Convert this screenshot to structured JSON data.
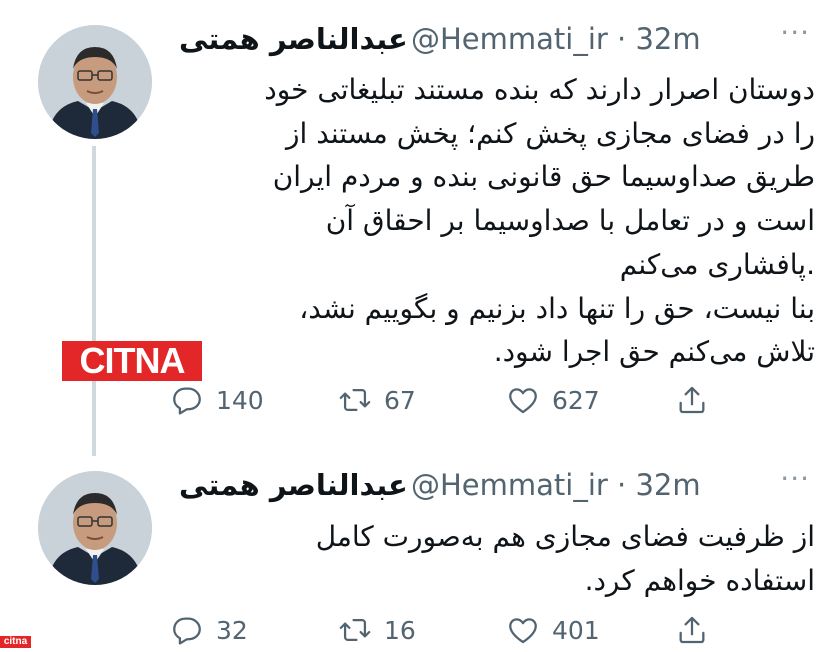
{
  "tweets": [
    {
      "author_name": "عبدالناصر همتی",
      "handle": "@Hemmati_ir",
      "separator": "·",
      "time": "32m",
      "more_icon": "more-horizontal-icon",
      "text_lines": [
        "دوستان اصرار دارند که بنده مستند تبلیغاتی خود",
        "را در فضای مجازی پخش کنم؛ پخش مستند از",
        "طریق صداوسیما حق قانونی بنده و مردم ایران",
        "است و در تعامل با صداوسیما بر احقاق آن",
        ".پافشاری می‌کنم",
        "بنا نیست، حق را تنها داد بزنیم و بگوییم نشد،",
        "تلاش می‌کنم حق اجرا شود."
      ],
      "replies": "140",
      "retweets": "67",
      "likes": "627"
    },
    {
      "author_name": "عبدالناصر همتی",
      "handle": "@Hemmati_ir",
      "separator": "·",
      "time": "32m",
      "more_icon": "more-horizontal-icon",
      "text_lines": [
        "از ظرفیت فضای مجازی هم به‌صورت کامل",
        "استفاده خواهم کرد."
      ],
      "replies": "32",
      "retweets": "16",
      "likes": "401"
    }
  ],
  "watermark": {
    "large": "CITNA",
    "small": "citna"
  },
  "colors": {
    "secondary_text": "#536471",
    "thread_line": "#cfd9de",
    "watermark": "#e32729"
  }
}
